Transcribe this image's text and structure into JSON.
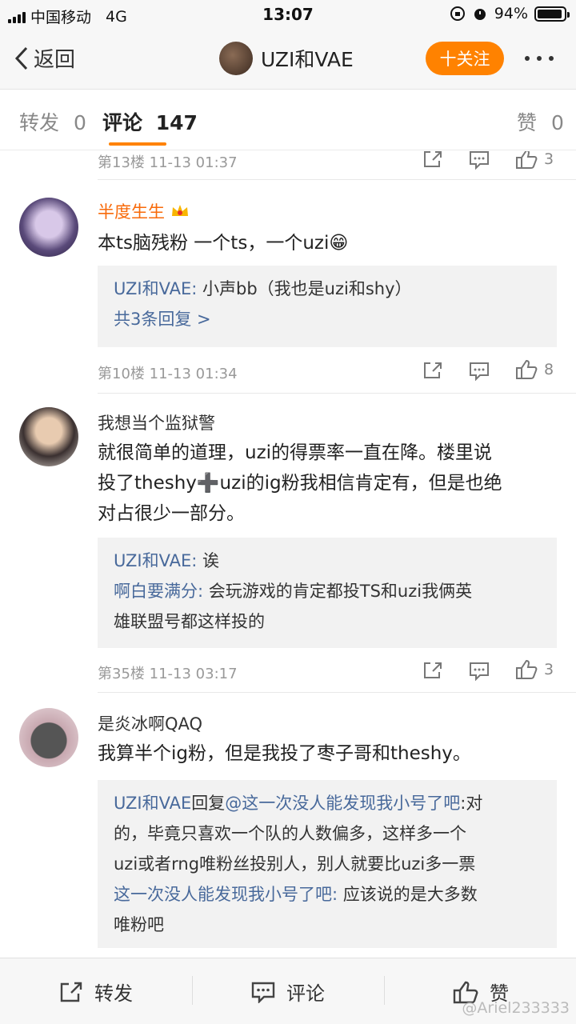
{
  "status": {
    "carrier": "中国移动",
    "network": "4G",
    "time": "13:07",
    "battery": "94%",
    "battery_level": 0.94
  },
  "nav": {
    "back_label": "返回",
    "title": "UZI和VAE",
    "follow_label": "十关注"
  },
  "tabs": {
    "repost": {
      "label": "转发",
      "count": "0"
    },
    "comment": {
      "label": "评论",
      "count": "147"
    },
    "like": {
      "label": "赞",
      "count": "0"
    }
  },
  "comments": [
    {
      "floor": "第13楼",
      "time": "11-13 01:37",
      "likes": "3"
    },
    {
      "username": "半度生生",
      "text": "本ts脑残粉 一个ts，一个uzi",
      "emoji": "😁",
      "replies": [
        {
          "user": "UZI和VAE",
          "sep": ": ",
          "text": "小声bb（我也是uzi和shy）"
        }
      ],
      "more_replies": "共3条回复 >",
      "floor": "第10楼",
      "time": "11-13 01:34",
      "likes": "8"
    },
    {
      "username": "我想当个监狱警",
      "text_lines": [
        "就很简单的道理，uzi的得票率一直在降。楼里说",
        "投了theshy➕uzi的ig粉我相信肯定有，但是也绝",
        "对占很少一部分。"
      ],
      "replies": [
        {
          "user": "UZI和VAE",
          "sep": ": ",
          "text": "诶"
        },
        {
          "user": "啊白要满分",
          "sep": ": ",
          "text": "会玩游戏的肯定都投TS和uzi我俩英",
          "text2": "雄联盟号都这样投的"
        }
      ],
      "floor": "第35楼",
      "time": "11-13 03:17",
      "likes": "3"
    },
    {
      "username": "是炎冰啊QAQ",
      "text": "我算半个ig粉，但是我投了枣子哥和theshy。",
      "replies": [
        {
          "user": "UZI和VAE",
          "mid": "回复",
          "mention": "@这一次没人能发现我小号了吧",
          "sep": ":",
          "text": "对",
          "line2": "的，毕竟只喜欢一个队的人数偏多，这样多一个",
          "line3": "uzi或者rng唯粉丝投别人，别人就要比uzi多一票"
        },
        {
          "user": "这一次没人能发现我小号了吧",
          "sep": ": ",
          "text": "应该说的是大多数",
          "text2": "唯粉吧"
        }
      ]
    }
  ],
  "bottom": {
    "repost": "转发",
    "comment": "评论",
    "like": "赞"
  },
  "watermark": "@Ariel233333",
  "colors": {
    "accent": "#ff8200",
    "link": "#48699b",
    "vip_name": "#f86a0a"
  }
}
